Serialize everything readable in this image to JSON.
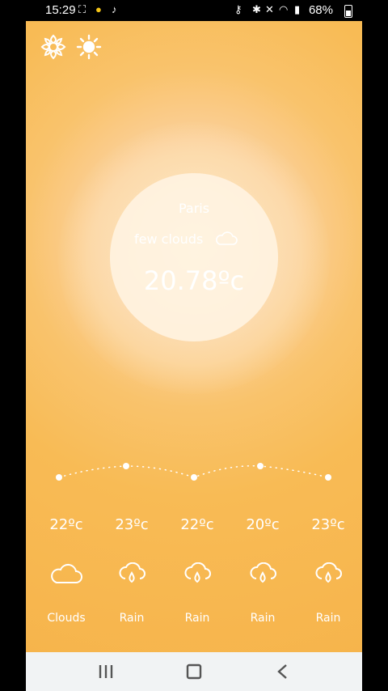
{
  "status_bar": {
    "time": "15:29",
    "battery": "68%"
  },
  "weather": {
    "city": "Paris",
    "description": "few clouds",
    "temperature": "20.78ºc"
  },
  "forecast": [
    {
      "temp": "22ºc",
      "label": "Clouds",
      "icon": "cloud-icon"
    },
    {
      "temp": "23ºc",
      "label": "Rain",
      "icon": "rain-icon"
    },
    {
      "temp": "22ºc",
      "label": "Rain",
      "icon": "rain-icon"
    },
    {
      "temp": "20ºc",
      "label": "Rain",
      "icon": "rain-icon"
    },
    {
      "temp": "23ºc",
      "label": "Rain",
      "icon": "rain-icon"
    }
  ],
  "colors": {
    "background": "#f6b34a",
    "text": "#ffffff"
  }
}
